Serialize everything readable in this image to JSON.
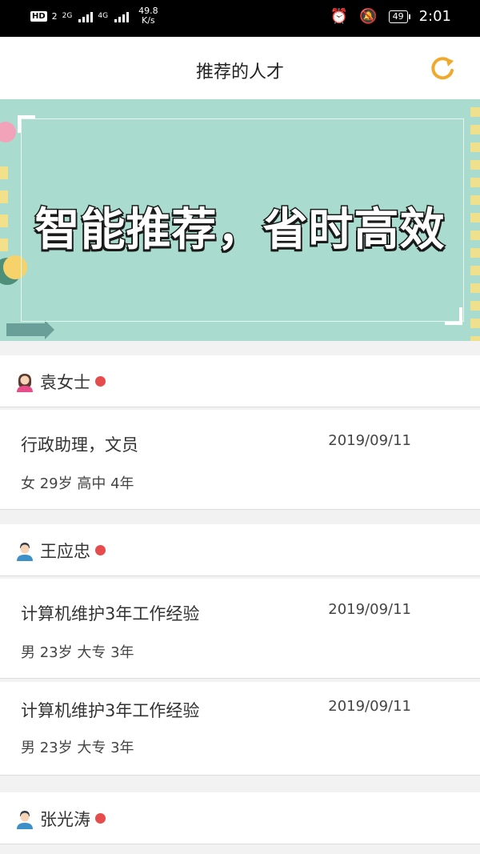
{
  "status_bar": {
    "hd": "HD",
    "sim": "2",
    "net1": "2G",
    "net2": "4G",
    "speed_value": "49.8",
    "speed_unit": "K/s",
    "battery": "49",
    "time": "2:01"
  },
  "header": {
    "title": "推荐的人才",
    "refresh_icon": "refresh-icon",
    "accent": "#f0a92b"
  },
  "banner": {
    "text": "智能推荐，省时高效",
    "bg": "#a9dccf"
  },
  "people": [
    {
      "name": "袁女士",
      "gender_icon": "female-avatar-icon",
      "jobs": [
        {
          "title": "行政助理，文员",
          "date": "2019/09/11",
          "meta": "女 29岁   高中 4年"
        }
      ]
    },
    {
      "name": "王应忠",
      "gender_icon": "male-avatar-icon",
      "jobs": [
        {
          "title": "计算机维护3年工作经验",
          "date": "2019/09/11",
          "meta": "男 23岁   大专 3年"
        },
        {
          "title": "计算机维护3年工作经验",
          "date": "2019/09/11",
          "meta": "男 23岁   大专 3年"
        }
      ]
    },
    {
      "name": "张光涛",
      "gender_icon": "male-avatar-icon",
      "jobs": []
    }
  ]
}
